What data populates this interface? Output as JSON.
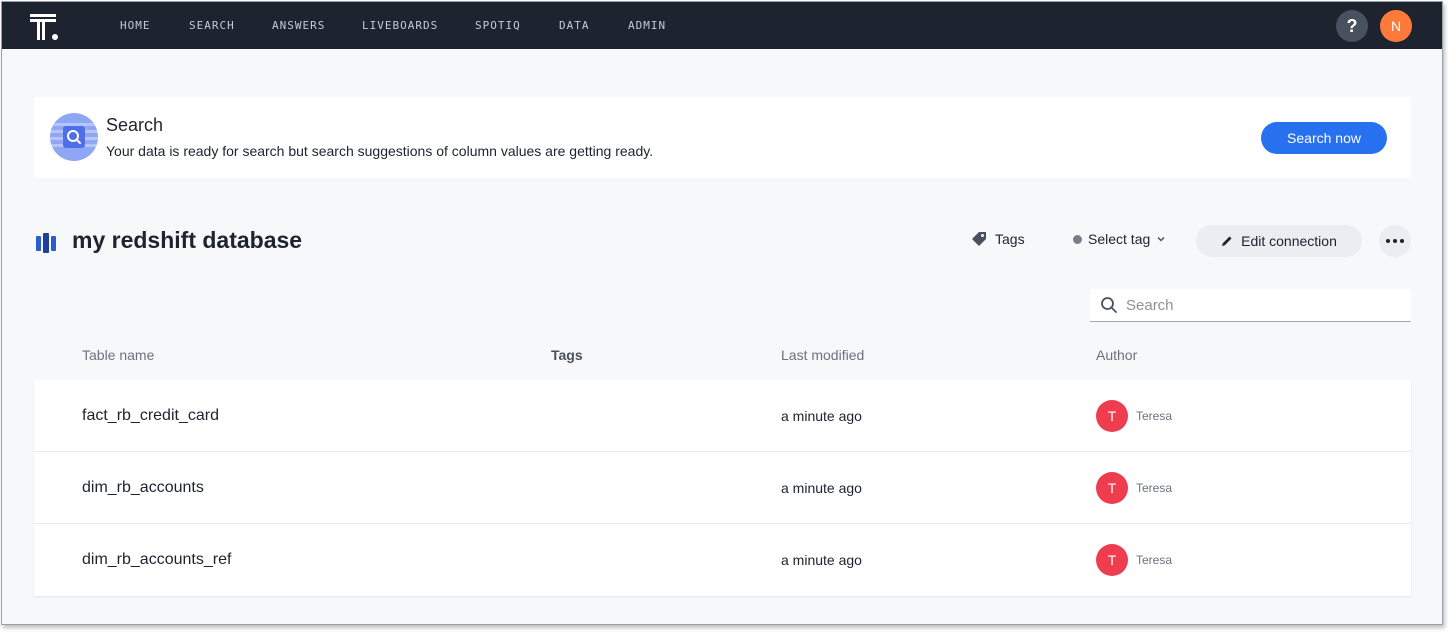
{
  "nav": {
    "items": [
      "HOME",
      "SEARCH",
      "ANSWERS",
      "LIVEBOARDS",
      "SPOTIQ",
      "DATA",
      "ADMIN"
    ],
    "help": "?",
    "user_initial": "N"
  },
  "banner": {
    "title": "Search",
    "description": "Your data is ready for search but search suggestions of column values are getting ready.",
    "button": "Search now"
  },
  "header": {
    "title": "my redshift database",
    "tags_label": "Tags",
    "select_tag_label": "Select tag",
    "edit_label": "Edit connection"
  },
  "search": {
    "placeholder": "Search"
  },
  "table": {
    "columns": [
      "Table name",
      "Tags",
      "Last modified",
      "Author"
    ],
    "rows": [
      {
        "name": "fact_rb_credit_card",
        "modified": "a minute ago",
        "author_initial": "T",
        "author": "Teresa"
      },
      {
        "name": "dim_rb_accounts",
        "modified": "a minute ago",
        "author_initial": "T",
        "author": "Teresa"
      },
      {
        "name": "dim_rb_accounts_ref",
        "modified": "a minute ago",
        "author_initial": "T",
        "author": "Teresa"
      }
    ]
  },
  "colors": {
    "nav_bg": "#1d232f",
    "primary": "#2770ef",
    "user_avatar": "#fe7a3a",
    "author_avatar": "#ee3d4f"
  },
  "icons": [
    "thoughtspot-logo-icon",
    "help-icon",
    "search-feature-icon",
    "database-icon",
    "tag-icon",
    "chevron-down-icon",
    "pencil-icon",
    "more-icon",
    "search-icon"
  ]
}
